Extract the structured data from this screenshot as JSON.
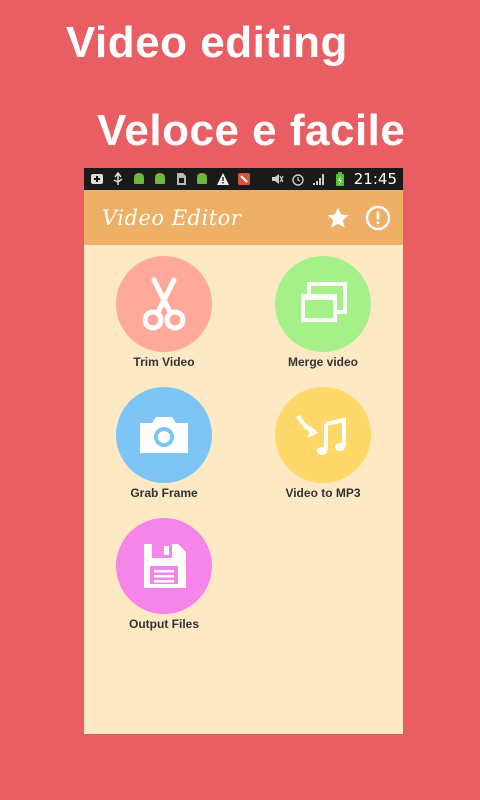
{
  "promo": {
    "line1": "Video editing",
    "line2": "Veloce e facile"
  },
  "status_bar": {
    "time": "21:45",
    "icons": [
      "notification-icon",
      "usb-icon",
      "android-icon",
      "android-icon",
      "sd-card-icon",
      "android-icon",
      "warning-icon",
      "app-icon",
      "mute-icon",
      "alarm-icon",
      "signal-icon",
      "battery-icon"
    ]
  },
  "app_bar": {
    "title": "Video Editor",
    "actions": [
      "star-icon",
      "info-icon"
    ]
  },
  "tiles": [
    {
      "label": "Trim Video",
      "color": "#FFA99A",
      "icon": "scissors-icon"
    },
    {
      "label": "Merge video",
      "color": "#A6F08A",
      "icon": "merge-icon"
    },
    {
      "label": "Grab Frame",
      "color": "#7CC5F4",
      "icon": "camera-icon"
    },
    {
      "label": "Video to MP3",
      "color": "#FFD86A",
      "icon": "music-icon"
    },
    {
      "label": "Output Files",
      "color": "#F685EA",
      "icon": "save-icon"
    }
  ],
  "colors": {
    "background": "#E95E62",
    "app_bar": "#EEB066",
    "content": "#FEE9C5"
  }
}
